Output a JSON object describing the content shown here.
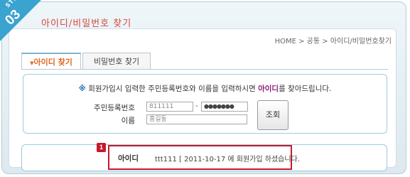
{
  "header": {
    "step_label": "STEP",
    "step_number": "03",
    "title": "아이디/비밀번호 찾기"
  },
  "breadcrumb": "HOME > 공통 > 아이디/비밀번호찾기",
  "tabs": [
    {
      "label": "아이디 찾기",
      "active": true
    },
    {
      "label": "비밀번호 찾기",
      "active": false
    }
  ],
  "form": {
    "notice_prefix": "※",
    "notice_text": "회원가입시 입력한 주민등록번호와 이름을 입력하시면",
    "notice_highlight": "아이디",
    "notice_suffix": "를 찾아드립니다.",
    "ssn_label": "주민등록번호",
    "ssn_front": "811111",
    "ssn_dash": "-",
    "ssn_back": "●●●●●●●",
    "name_label": "이름",
    "name_value": "홍길동",
    "submit_label": "조회"
  },
  "result": {
    "badge": "1",
    "label": "아이디",
    "text": "ttt111  [ 2011-10-17 에 회원가입 하셨습니다."
  },
  "colors": {
    "accent": "#3aa3cf",
    "title_red": "#d8473b",
    "highlight_red": "#c5192d",
    "tab_active": "#e0641b"
  }
}
